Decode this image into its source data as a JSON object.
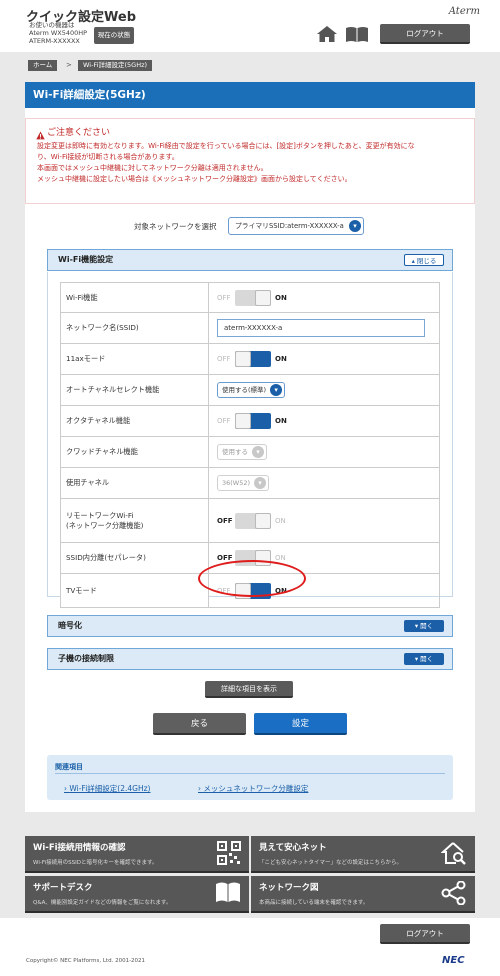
{
  "header": {
    "title": "クイック設定Web",
    "device_line1": "お使いの機器は",
    "device_line2": "Aterm WX5400HP",
    "device_line3": "ATERM-XXXXXX",
    "status_button": "現在の状態",
    "brand": "Aterm",
    "logout": "ログアウト"
  },
  "breadcrumb": {
    "home": "ホーム",
    "separator": ">",
    "current": "Wi-Fi詳細設定(5GHz)"
  },
  "page_title": "Wi-Fi詳細設定(5GHz)",
  "caution": {
    "title": "ご注意ください",
    "line1": "設定変更は即時に有効となります。Wi-Fi経由で設定を行っている場合には、[設定]ボタンを押したあと、変更が有効にな",
    "line2": "り、Wi-Fi接続が切断される場合があります。",
    "line3": "本画面ではメッシュ中継機に対してネットワーク分離は適用されません。",
    "line4": "メッシュ中継機に設定したい場合は《メッシュネットワーク分離設定》画面から設定してください。"
  },
  "target_network": {
    "label": "対象ネットワークを選択",
    "selected": "プライマリSSID:aterm-XXXXXX-a"
  },
  "wifi_function": {
    "title": "Wi-Fi機能設定",
    "toggle_label": "閉じる",
    "rows": [
      {
        "label": "Wi-Fi機能",
        "off": "OFF",
        "on": "ON"
      },
      {
        "label": "ネットワーク名(SSID)",
        "value": "aterm-XXXXXX-a"
      },
      {
        "label": "11axモード",
        "off": "OFF",
        "on": "ON"
      },
      {
        "label": "オートチャネルセレクト機能",
        "value": "使用する(標準)"
      },
      {
        "label": "オクタチャネル機能",
        "off": "OFF",
        "on": "ON"
      },
      {
        "label": "クワッドチャネル機能",
        "value": "使用する"
      },
      {
        "label": "使用チャネル",
        "value": "36(W52)"
      },
      {
        "label": "リモートワークWi-Fi",
        "label2": "(ネットワーク分離機能)",
        "off": "OFF",
        "on": "ON"
      },
      {
        "label": "SSID内分離(セパレータ)",
        "off": "OFF",
        "on": "ON"
      },
      {
        "label": "TVモード",
        "off": "OFF",
        "on": "ON"
      }
    ]
  },
  "encryption": {
    "title": "暗号化",
    "toggle_label": "開く"
  },
  "child_limit": {
    "title": "子機の接続制限",
    "toggle_label": "開く"
  },
  "buttons": {
    "detail": "詳細な項目を表示",
    "back": "戻る",
    "set": "設定"
  },
  "related": {
    "title": "関連項目",
    "link1": "Wi-Fi詳細設定(2.4GHz)",
    "link2": "メッシュネットワーク分離設定"
  },
  "tiles": [
    {
      "title": "Wi-Fi接続用情報の確認",
      "sub": "Wi-Fi接続用のSSIDと暗号化キーを確認できます。",
      "icon": "qr-code-icon"
    },
    {
      "title": "見えて安心ネット",
      "sub": "「こども安心ネットタイマー」などの設定はこちらから。",
      "icon": "home-search-icon"
    },
    {
      "title": "サポートデスク",
      "sub": "Q&A、機能別設定ガイドなどの情報をご覧になれます。",
      "icon": "book-icon"
    },
    {
      "title": "ネットワーク図",
      "sub": "本商品に接続している端末を確認できます。",
      "icon": "network-icon"
    }
  ],
  "footer": {
    "logout": "ログアウト",
    "copyright": "Copyright© NEC Platforms, Ltd. 2001-2021",
    "logo": "NEC"
  },
  "colors": {
    "accent_blue": "#1a6fb8",
    "caution_red": "#c12a2a",
    "dark_button": "#5a5a5a",
    "highlight_circle": "#e01b1b"
  }
}
